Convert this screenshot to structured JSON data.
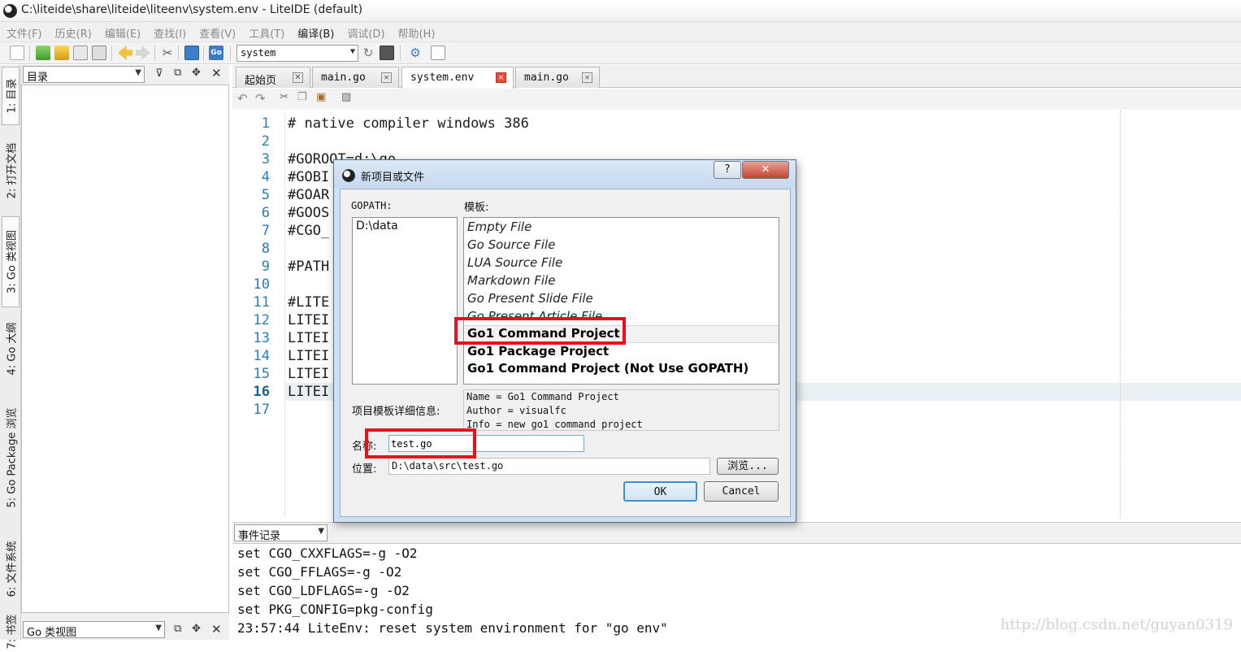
{
  "window": {
    "title": "C:\\liteide\\share\\liteide\\liteenv\\system.env - LiteIDE (default)"
  },
  "menu": [
    "文件(F)",
    "历史(R)",
    "编辑(E)",
    "查找(I)",
    "查看(V)",
    "工具(T)",
    "编译(B)",
    "调试(D)",
    "帮助(H)"
  ],
  "toolbar": {
    "env_select": "system"
  },
  "left_tabs": [
    "1: 目录",
    "2: 打开文档",
    "3: Go 类视图",
    "4: Go 大纲",
    "5: Go Package 浏览",
    "6: 文件系统",
    "7: 书签"
  ],
  "left_panel": {
    "top_select": "目录",
    "bottom_select": "Go 类视图"
  },
  "editor": {
    "tabs": [
      "起始页",
      "main.go",
      "system.env",
      "main.go"
    ],
    "active_tab": "system.env",
    "line_numbers": [
      "1",
      "2",
      "3",
      "4",
      "5",
      "6",
      "7",
      "8",
      "9",
      "10",
      "11",
      "12",
      "13",
      "14",
      "15",
      "16",
      "17"
    ],
    "lines": [
      "# native compiler windows 386",
      "",
      "#GOROOT=d:\\go",
      "#GOBI",
      "#GOAR",
      "#GOOS",
      "#CGO_",
      "",
      "#PATH",
      "",
      "#LITE",
      "LITEI",
      "LITEI",
      "LITEI",
      "LITEI",
      "LITEI",
      ""
    ],
    "current_line": "16"
  },
  "event_log": {
    "select": "事件记录",
    "lines": [
      "set CGO_CXXFLAGS=-g -O2",
      "set CGO_FFLAGS=-g -O2",
      "set CGO_LDFLAGS=-g -O2",
      "set PKG_CONFIG=pkg-config",
      "23:57:44 LiteEnv: reset system environment for \"go env\""
    ]
  },
  "dialog": {
    "title": "新项目或文件",
    "help_label": "?",
    "close_label": "✕",
    "gopath_label": "GOPATH:",
    "gopath_items": [
      "D:\\data"
    ],
    "template_label": "模板:",
    "templates": [
      "Empty File",
      "Go Source File",
      "LUA Source File",
      "Markdown File",
      "Go Present Slide File",
      "Go Present Article File",
      "Go1 Command Project",
      "Go1 Package Project",
      "Go1 Command Project (Not Use GOPATH)"
    ],
    "selected_template": "Go1 Command Project",
    "details_label": "项目模板详细信息:",
    "details": [
      "Name = Go1 Command Project",
      "Author = visualfc",
      "Info = new go1 command project"
    ],
    "name_label": "名称:",
    "name_value": "test.go",
    "location_label": "位置:",
    "location_value": "D:\\data\\src\\test.go",
    "browse_label": "浏览...",
    "ok_label": "OK",
    "cancel_label": "Cancel"
  },
  "watermark": "http://blog.csdn.net/guyan0319",
  "highlight_color": "#e8101a"
}
